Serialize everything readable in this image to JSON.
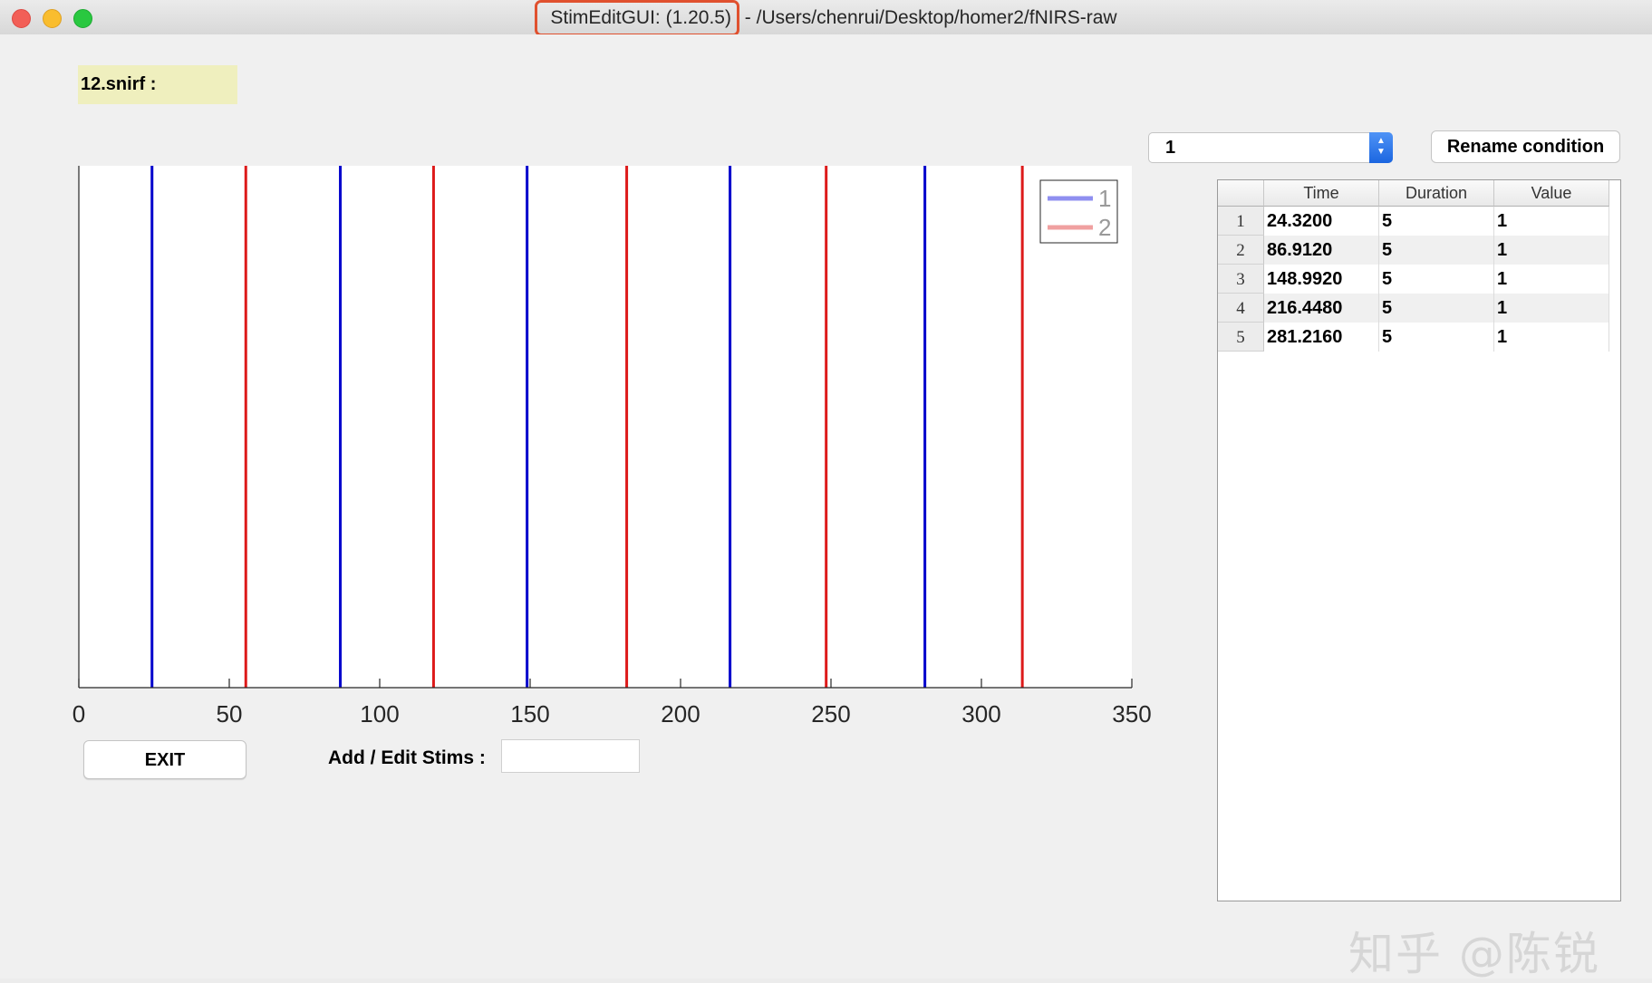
{
  "window": {
    "title_app": "StimEditGUI: (1.20.5)",
    "title_path": " - /Users/chenrui/Desktop/homer2/fNIRS-raw"
  },
  "file_label": "12.snirf :",
  "buttons": {
    "exit": "EXIT",
    "rename": "Rename condition"
  },
  "add_edit_label": "Add / Edit Stims :",
  "add_edit_value": "",
  "condition_select": {
    "selected": "1"
  },
  "table": {
    "columns": [
      "Time",
      "Duration",
      "Value"
    ],
    "rows": [
      {
        "index": "1",
        "time": "24.3200",
        "duration": "5",
        "value": "1"
      },
      {
        "index": "2",
        "time": "86.9120",
        "duration": "5",
        "value": "1"
      },
      {
        "index": "3",
        "time": "148.9920",
        "duration": "5",
        "value": "1"
      },
      {
        "index": "4",
        "time": "216.4480",
        "duration": "5",
        "value": "1"
      },
      {
        "index": "5",
        "time": "281.2160",
        "duration": "5",
        "value": "1"
      }
    ]
  },
  "watermark": "知乎 @陈锐",
  "chart_data": {
    "type": "line",
    "xlim": [
      0,
      350
    ],
    "xticks": [
      0,
      50,
      100,
      150,
      200,
      250,
      300,
      350
    ],
    "legend_position": "top-right",
    "series": [
      {
        "name": "1",
        "color": "#0000cc",
        "legend_color": "#8f8ff0",
        "x": [
          24.32,
          86.912,
          148.992,
          216.448,
          281.216
        ]
      },
      {
        "name": "2",
        "color": "#dd1a1a",
        "legend_color": "#f0a0a0",
        "x": [
          55.5,
          117.9,
          182.1,
          248.4,
          313.6
        ]
      }
    ]
  }
}
